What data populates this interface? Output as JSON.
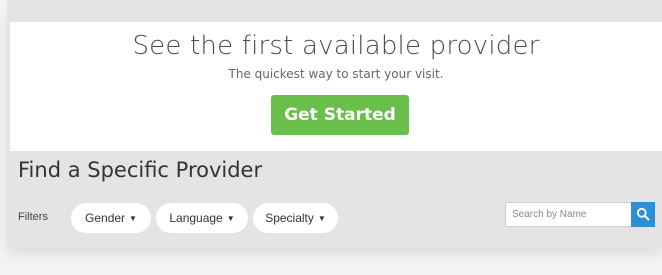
{
  "hero": {
    "title": "See the first available provider",
    "subtitle": "The quickest way to start your visit.",
    "cta_label": "Get Started",
    "cta_color": "#6abf4b"
  },
  "finder": {
    "title": "Find a Specific Provider",
    "filters_label": "Filters",
    "filters": [
      {
        "label": "Gender"
      },
      {
        "label": "Language"
      },
      {
        "label": "Specialty"
      }
    ],
    "search": {
      "placeholder": "Search by Name",
      "button_icon": "search-icon",
      "button_color": "#2d8fd5"
    }
  }
}
